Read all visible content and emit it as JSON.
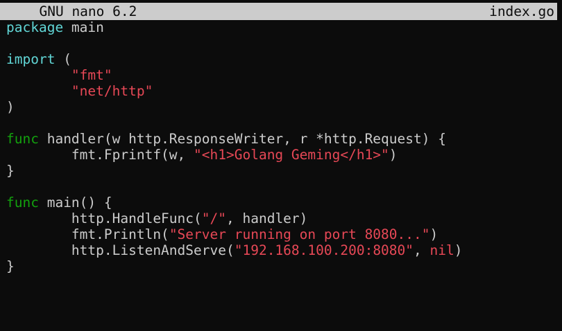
{
  "titlebar": {
    "app_name": "  GNU nano 6.2",
    "filename": "index.go"
  },
  "colors": {
    "background": "#0c0c0c",
    "foreground": "#cccccc",
    "keyword_cyan": "#61d6d6",
    "keyword_green": "#13a10e",
    "string": "#e74856",
    "titlebar_bg": "#cccccc"
  },
  "lines": [
    [
      {
        "t": "package",
        "c": "kw-cyan"
      },
      {
        "t": " main",
        "c": "plain"
      }
    ],
    [],
    [
      {
        "t": "import",
        "c": "kw-cyan"
      },
      {
        "t": " (",
        "c": "plain"
      }
    ],
    [
      {
        "t": "        ",
        "c": "plain"
      },
      {
        "t": "\"fmt\"",
        "c": "str"
      }
    ],
    [
      {
        "t": "        ",
        "c": "plain"
      },
      {
        "t": "\"net/http\"",
        "c": "str"
      }
    ],
    [
      {
        "t": ")",
        "c": "plain"
      }
    ],
    [],
    [
      {
        "t": "func",
        "c": "kw-green"
      },
      {
        "t": " handler(w http.ResponseWriter, r *http.Request) {",
        "c": "plain"
      }
    ],
    [
      {
        "t": "        fmt.Fprintf(w, ",
        "c": "plain"
      },
      {
        "t": "\"<h1>Golang Geming</h1>\"",
        "c": "str"
      },
      {
        "t": ")",
        "c": "plain"
      }
    ],
    [
      {
        "t": "}",
        "c": "plain"
      }
    ],
    [],
    [
      {
        "t": "func",
        "c": "kw-green"
      },
      {
        "t": " main() {",
        "c": "plain"
      }
    ],
    [
      {
        "t": "        http.HandleFunc(",
        "c": "plain"
      },
      {
        "t": "\"/\"",
        "c": "str"
      },
      {
        "t": ", handler)",
        "c": "plain"
      }
    ],
    [
      {
        "t": "        fmt.Println(",
        "c": "plain"
      },
      {
        "t": "\"Server running on port 8080...\"",
        "c": "str"
      },
      {
        "t": ")",
        "c": "plain"
      }
    ],
    [
      {
        "t": "        http.ListenAndServe(",
        "c": "plain"
      },
      {
        "t": "\"192.168.100.200:8080\"",
        "c": "str"
      },
      {
        "t": ", ",
        "c": "plain"
      },
      {
        "t": "nil",
        "c": "str"
      },
      {
        "t": ")",
        "c": "plain"
      }
    ],
    [
      {
        "t": "}",
        "c": "plain"
      }
    ]
  ]
}
